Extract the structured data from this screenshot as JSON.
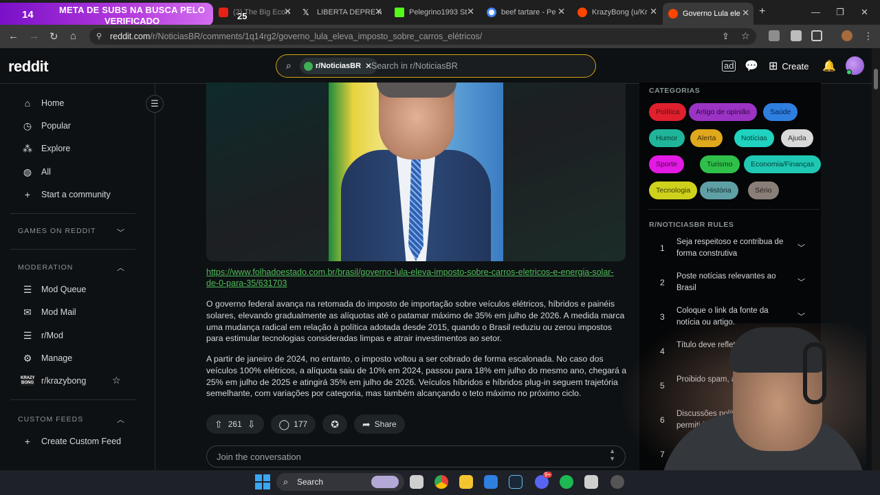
{
  "browser": {
    "banner": {
      "count": "14",
      "line1": "META DE SUBS NA BUSCA PELO",
      "line2": "VERIFICADO",
      "count2": "25"
    },
    "tabs": [
      {
        "title": "(2) The Big Econ",
        "color": "#e62117"
      },
      {
        "title": "LIBERTA DEPRE n",
        "color": "#ffffff"
      },
      {
        "title": "Pelegrino1993 St",
        "color": "#53fc18"
      },
      {
        "title": "beef tartare - Pe",
        "color": "#4285f4"
      },
      {
        "title": "KrazyBong (u/Kr",
        "color": "#ff4500"
      },
      {
        "title": "Governo Lula ele",
        "color": "#ff4500"
      }
    ],
    "url_host": "reddit.com",
    "url_path": "/r/NoticiasBR/comments/1q14rg2/governo_lula_eleva_imposto_sobre_carros_elétricos/"
  },
  "header": {
    "logo": "reddit",
    "search_chip": "r/NoticiasBR",
    "search_placeholder": "Search in r/NoticiasBR",
    "create_label": "Create"
  },
  "sidebar": {
    "items": [
      {
        "label": "Home",
        "icon": "home-icon"
      },
      {
        "label": "Popular",
        "icon": "popular-icon"
      },
      {
        "label": "Explore",
        "icon": "explore-icon"
      },
      {
        "label": "All",
        "icon": "all-icon"
      },
      {
        "label": "Start a community",
        "icon": "plus-icon"
      }
    ],
    "games_title": "GAMES ON REDDIT",
    "moderation_title": "MODERATION",
    "moderation_items": [
      {
        "label": "Mod Queue",
        "icon": "mod-queue-icon"
      },
      {
        "label": "Mod Mail",
        "icon": "mod-mail-icon"
      },
      {
        "label": "r/Mod",
        "icon": "rmod-icon"
      },
      {
        "label": "Manage",
        "icon": "gear-icon"
      },
      {
        "label": "r/krazybong",
        "icon": "krazybong-icon"
      }
    ],
    "krazy_badge": "KRAZY BONG",
    "custom_feeds_title": "CUSTOM FEEDS",
    "create_custom_feed": "Create Custom Feed"
  },
  "post": {
    "link": "https://www.folhadoestado.com.br/brasil/governo-lula-eleva-imposto-sobre-carros-eletricos-e-energia-solar-de-0-para-35/631703",
    "paragraph1": "O governo federal avança na retomada do imposto de importação sobre veículos elétricos, híbridos e painéis solares, elevando gradualmente as alíquotas até o patamar máximo de 35% em julho de 2026. A medida marca uma mudança radical em relação à política adotada desde 2015, quando o Brasil reduziu ou zerou impostos para estimular tecnologias consideradas limpas e atrair investimentos ao setor.",
    "paragraph2": "A partir de janeiro de 2024, no entanto, o imposto voltou a ser cobrado de forma escalonada. No caso dos veículos 100% elétricos, a alíquota saiu de 10% em 2024, passou para 18% em julho do mesmo ano, chegará a 25% em julho de 2025 e atingirá 35% em julho de 2026. Veículos híbridos e híbridos plug-in seguem trajetória semelhante, com variações por categoria, mas também alcançando o teto máximo no próximo ciclo.",
    "votes": "261",
    "comments": "177",
    "share_label": "Share",
    "join_placeholder": "Join the conversation"
  },
  "right_sidebar": {
    "categories_title": "CATEGORIAS",
    "categories": [
      {
        "label": "Política",
        "bg": "#e0202d",
        "fg": "#5a0b10"
      },
      {
        "label": "Artigo de opinião",
        "bg": "#9b33c4",
        "fg": "#2b0b3a"
      },
      {
        "label": "Saúde",
        "bg": "#2f7fe0",
        "fg": "#0b2448"
      },
      {
        "label": "Humor",
        "bg": "#1fb59b",
        "fg": "#0a3a31"
      },
      {
        "label": "Alerta",
        "bg": "#e0a81c",
        "fg": "#3e2c06"
      },
      {
        "label": "Notícias",
        "bg": "#20d2c0",
        "fg": "#07403a"
      },
      {
        "label": "Ajuda",
        "bg": "#d9d9d9",
        "fg": "#333333"
      },
      {
        "label": "Sporte",
        "bg": "#e31ae3",
        "fg": "#4a064a"
      },
      {
        "label": "Turismo",
        "bg": "#2fc04a",
        "fg": "#0b3a14"
      },
      {
        "label": "Economia/Finanças",
        "bg": "#1fc8b3",
        "fg": "#063d36"
      },
      {
        "label": "Tecnologia",
        "bg": "#cfd21c",
        "fg": "#3a3b05"
      },
      {
        "label": "História",
        "bg": "#5fa0a6",
        "fg": "#10292b"
      },
      {
        "label": "Sério",
        "bg": "#8a7f78",
        "fg": "#241f1c"
      }
    ],
    "rules_title": "R/NOTICIASBR RULES",
    "rules": [
      {
        "n": "1",
        "text": "Seja respeitoso e contribua de forma construtiva"
      },
      {
        "n": "2",
        "text": "Poste notícias relevantes ao Brasil"
      },
      {
        "n": "3",
        "text": "Coloque o link da fonte da notícia ou artigo."
      },
      {
        "n": "4",
        "text": "Título deve refletir da notícia"
      },
      {
        "n": "5",
        "text": "Proibido spam, a propaganda"
      },
      {
        "n": "6",
        "text": "Discussões políticas s permitidas"
      },
      {
        "n": "7",
        "text": "Na"
      }
    ]
  },
  "taskbar": {
    "search_label": "Search",
    "discord_badge": "9+"
  }
}
